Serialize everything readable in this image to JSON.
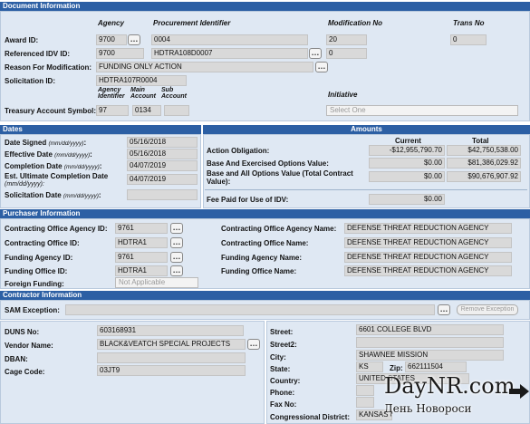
{
  "sections": {
    "document": "Document Information",
    "dates": "Dates",
    "amounts": "Amounts",
    "purchaser": "Purchaser Information",
    "contractor": "Contractor Information"
  },
  "doc": {
    "col_agency": "Agency",
    "col_procurement": "Procurement Identifier",
    "col_modification": "Modification No",
    "col_trans": "Trans No",
    "award_id_label": "Award ID:",
    "award_agency": "9700",
    "award_procurement": "0004",
    "award_modification": "20",
    "award_trans": "0",
    "ref_idv_label": "Referenced IDV ID:",
    "ref_agency": "9700",
    "ref_procurement": "HDTRA108D0007",
    "ref_modification": "0",
    "reason_label": "Reason For Modification:",
    "reason_value": "FUNDING ONLY ACTION",
    "solicitation_label": "Solicitation ID:",
    "solicitation_value": "HDTRA107R0004",
    "col_agency_identifier": "Agency Identifier",
    "col_main_account": "Main Account",
    "col_sub_account": "Sub Account",
    "col_initiative": "Initiative",
    "tas_label": "Treasury Account Symbol:",
    "tas_agency": "97",
    "tas_main": "0134",
    "tas_sub": "",
    "initiative_placeholder": "Select One"
  },
  "dates": {
    "signed_label": "Date Signed",
    "signed_fmt": "(mm/dd/yyyy)",
    "signed_value": "05/16/2018",
    "effective_label": "Effective Date",
    "effective_fmt": "(mm/dd/yyyy)",
    "effective_value": "05/16/2018",
    "completion_label": "Completion Date",
    "completion_fmt": "(mm/dd/yyyy)",
    "completion_value": "04/07/2019",
    "ultimate_label_1": "Est. Ultimate Completion Date",
    "ultimate_label_2": "(mm/dd/yyyy):",
    "ultimate_value": "04/07/2019",
    "solicitation_label": "Solicitation Date",
    "solicitation_fmt": "(mm/dd/yyyy)",
    "solicitation_value": ""
  },
  "amounts": {
    "col_current": "Current",
    "col_total": "Total",
    "obligation_label": "Action Obligation:",
    "obligation_current": "-$12,955,790.70",
    "obligation_total": "$42,750,538.00",
    "exercised_label": "Base And Exercised Options Value:",
    "exercised_current": "$0.00",
    "exercised_total": "$81,386,029.92",
    "all_options_label_1": "Base and All Options Value (Total Contract",
    "all_options_label_2": "Value):",
    "all_options_current": "$0.00",
    "all_options_total": "$90,676,907.92",
    "fee_label": "Fee Paid for Use of IDV:",
    "fee_value": "$0.00"
  },
  "purchaser": {
    "co_agency_id_label": "Contracting Office Agency ID:",
    "co_agency_id": "9761",
    "co_id_label": "Contracting Office ID:",
    "co_id": "HDTRA1",
    "funding_agency_id_label": "Funding Agency ID:",
    "funding_agency_id": "9761",
    "funding_office_id_label": "Funding Office ID:",
    "funding_office_id": "HDTRA1",
    "foreign_label": "Foreign Funding:",
    "foreign_value": "Not Applicable",
    "co_agency_name_label": "Contracting Office Agency Name:",
    "co_agency_name": "DEFENSE THREAT REDUCTION AGENCY",
    "co_name_label": "Contracting Office Name:",
    "co_name": "DEFENSE THREAT REDUCTION AGENCY",
    "funding_agency_name_label": "Funding Agency Name:",
    "funding_agency_name": "DEFENSE THREAT REDUCTION AGENCY",
    "funding_office_name_label": "Funding Office Name:",
    "funding_office_name": "DEFENSE THREAT REDUCTION AGENCY"
  },
  "contractor": {
    "sam_label": "SAM Exception:",
    "sam_value": "",
    "remove_exception": "Remove Exception",
    "duns_label": "DUNS No:",
    "duns": "603168931",
    "vendor_label": "Vendor Name:",
    "vendor": "BLACK&VEATCH SPECIAL PROJECTS",
    "dban_label": "DBAN:",
    "dban": "",
    "cage_label": "Cage Code:",
    "cage": "03JT9",
    "street_label": "Street:",
    "street": "6601 COLLEGE BLVD",
    "street2_label": "Street2:",
    "street2": "",
    "city_label": "City:",
    "city": "SHAWNEE MISSION",
    "state_label": "State:",
    "state": "KS",
    "zip_label": "Zip:",
    "zip": "662111504",
    "country_label": "Country:",
    "country": "UNITED STATES",
    "phone_label": "Phone:",
    "phone": "",
    "fax_label": "Fax No:",
    "fax": "",
    "district_label": "Congressional District:",
    "district": "KANSAS 03"
  },
  "watermark": {
    "brand": "DayNR.com",
    "tagline": "День Новороси"
  },
  "ellipsis": "…",
  "colors": {
    "header_blue": "#2c5fa4",
    "section_bg": "#dfe8f3",
    "field_gray": "#d9d9d9"
  }
}
